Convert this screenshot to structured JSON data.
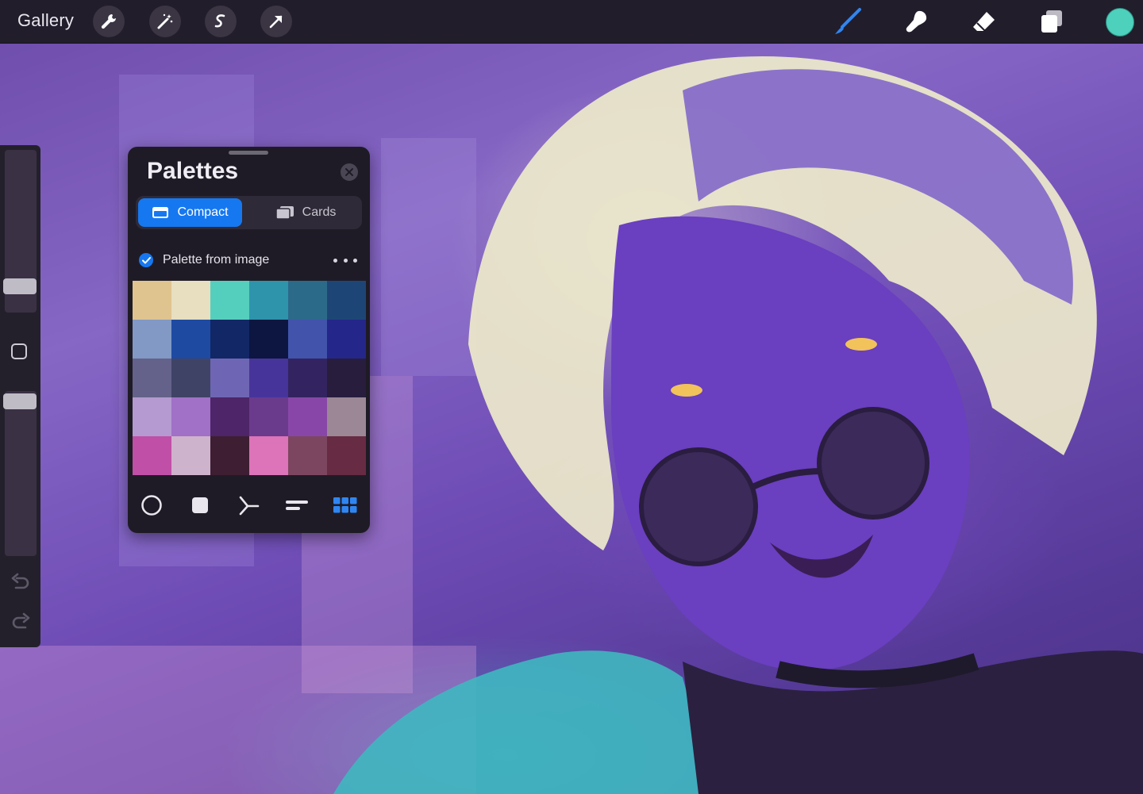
{
  "topbar": {
    "gallery_label": "Gallery",
    "left_tools": [
      "wrench-icon",
      "magic-wand-icon",
      "selection-icon",
      "transform-arrow-icon"
    ],
    "right_tools": [
      "brush-icon",
      "smudge-icon",
      "eraser-icon",
      "layers-icon"
    ],
    "current_color": "#4dd0bc"
  },
  "palettes": {
    "title": "Palettes",
    "tabs": [
      {
        "label": "Compact",
        "selected": true
      },
      {
        "label": "Cards",
        "selected": false
      }
    ],
    "palette_name": "Palette from image",
    "palette_default": true,
    "swatches": [
      "#dfc48f",
      "#e7dfc0",
      "#55cfbd",
      "#2e94ac",
      "#2c6a8a",
      "#1d4676",
      "#8199c4",
      "#1e4aa2",
      "#122766",
      "#0c1640",
      "#4153ab",
      "#24268a",
      "#64628a",
      "#3f4466",
      "#6e66b4",
      "#47349a",
      "#332461",
      "#281d3d",
      "#b49ad0",
      "#a071c6",
      "#4e2568",
      "#6a3b8c",
      "#8847a8",
      "#9b8795",
      "#c04fa7",
      "#ceb3cd",
      "#3e1e32",
      "#dd73b9",
      "#7d4660",
      "#672b43"
    ],
    "view_modes": [
      "disc-icon",
      "classic-icon",
      "harmony-icon",
      "value-icon",
      "palettes-grid-icon"
    ],
    "active_view": "palettes-grid-icon"
  },
  "accent": "#1678f0"
}
